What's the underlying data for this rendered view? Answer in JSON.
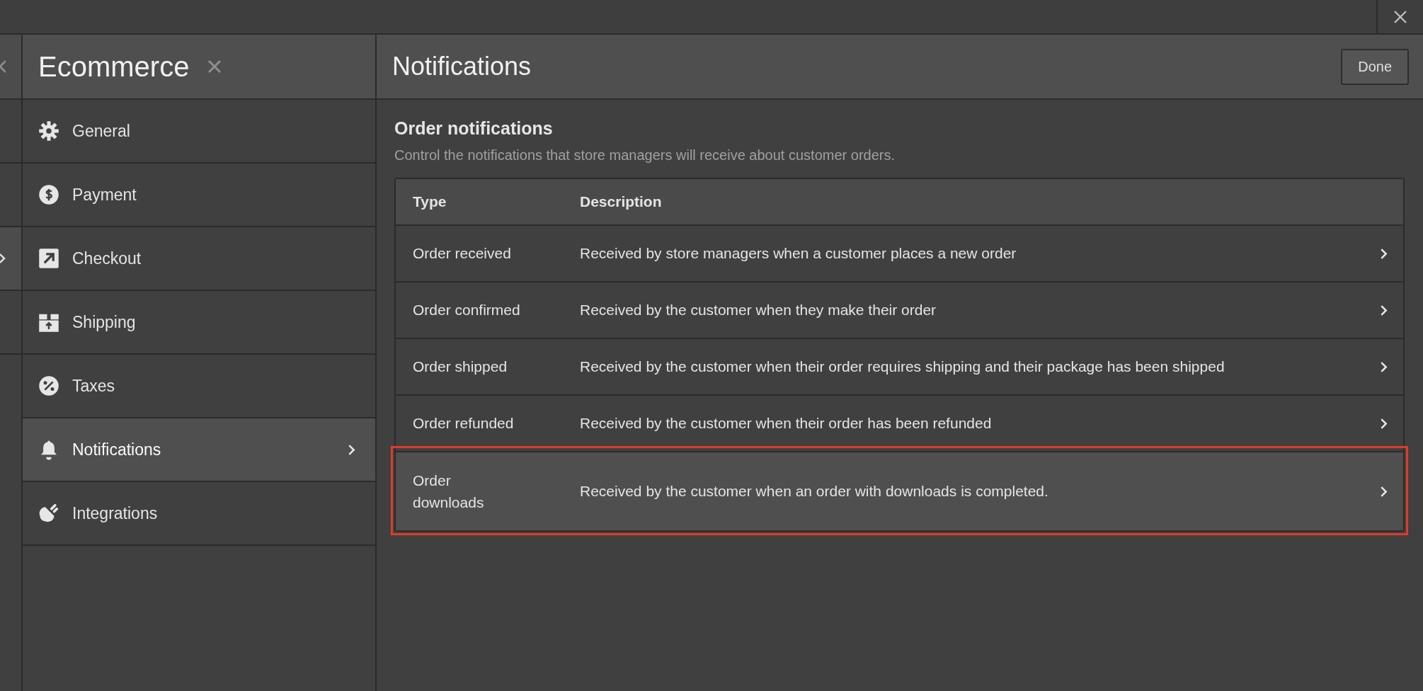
{
  "previous_panel": {
    "rows": [
      {
        "selected": false
      },
      {
        "selected": false
      },
      {
        "selected": true
      },
      {
        "selected": false
      }
    ]
  },
  "sidebar": {
    "title": "Ecommerce",
    "items": [
      {
        "label": "General",
        "kind": "gear",
        "selected": false
      },
      {
        "label": "Payment",
        "kind": "dollar",
        "selected": false
      },
      {
        "label": "Checkout",
        "kind": "arrow",
        "selected": false
      },
      {
        "label": "Shipping",
        "kind": "box",
        "selected": false
      },
      {
        "label": "Taxes",
        "kind": "percent",
        "selected": false
      },
      {
        "label": "Notifications",
        "kind": "bell",
        "selected": true
      },
      {
        "label": "Integrations",
        "kind": "plug",
        "selected": false
      }
    ]
  },
  "panel": {
    "title": "Notifications",
    "done_button": "Done"
  },
  "section": {
    "title": "Order notifications",
    "description": "Control the notifications that store managers will receive about customer orders."
  },
  "table": {
    "columns": [
      "Type",
      "Description"
    ],
    "rows": [
      {
        "type": "Order received",
        "description": "Received by store managers when a customer places a new order",
        "highlighted": false
      },
      {
        "type": "Order confirmed",
        "description": "Received by the customer when they make their order",
        "highlighted": false
      },
      {
        "type": "Order shipped",
        "description": "Received by the customer when their order requires shipping and their package has been shipped",
        "highlighted": false
      },
      {
        "type": "Order refunded",
        "description": "Received by the customer when their order has been refunded",
        "highlighted": false
      },
      {
        "type": "Order downloads",
        "description": "Received by the customer when an order with downloads is completed.",
        "highlighted": true
      }
    ]
  }
}
